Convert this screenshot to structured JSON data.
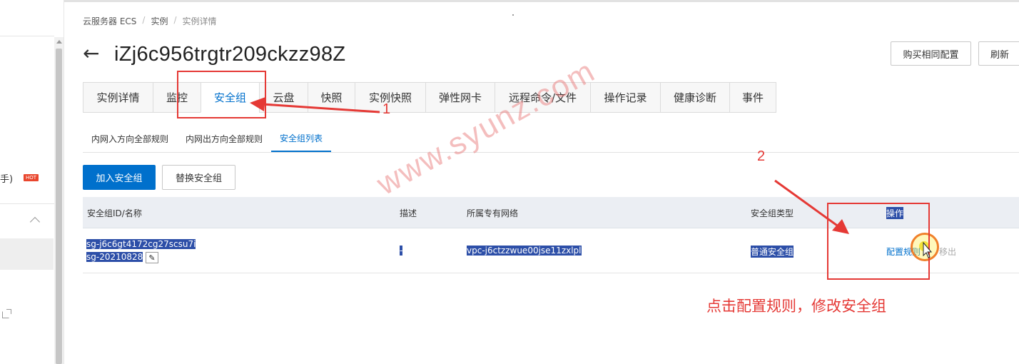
{
  "breadcrumb": [
    "云服务器 ECS",
    "实例",
    "实例详情"
  ],
  "instance_title": "iZj6c956trgtr209ckzz98Z",
  "header_buttons": {
    "buy_same": "购买相同配置",
    "refresh": "刷新"
  },
  "tabs": [
    {
      "label": "实例详情",
      "active": false
    },
    {
      "label": "监控",
      "active": false
    },
    {
      "label": "安全组",
      "active": true
    },
    {
      "label": "云盘",
      "active": false
    },
    {
      "label": "快照",
      "active": false
    },
    {
      "label": "实例快照",
      "active": false
    },
    {
      "label": "弹性网卡",
      "active": false
    },
    {
      "label": "远程命令/文件",
      "active": false
    },
    {
      "label": "操作记录",
      "active": false
    },
    {
      "label": "健康诊断",
      "active": false
    },
    {
      "label": "事件",
      "active": false
    }
  ],
  "subtabs": [
    {
      "label": "内网入方向全部规则",
      "active": false
    },
    {
      "label": "内网出方向全部规则",
      "active": false
    },
    {
      "label": "安全组列表",
      "active": true
    }
  ],
  "actions": {
    "add": "加入安全组",
    "replace": "替换安全组"
  },
  "table": {
    "headers": {
      "id_name": "安全组ID/名称",
      "description": "描述",
      "vpc": "所属专有网络",
      "type": "安全组类型",
      "ops": "操作"
    },
    "rows": [
      {
        "id": "sg-j6c6gt4172cg27scsu7i",
        "name": "sg-20210828",
        "description": "-",
        "vpc": "vpc-j6ctzzwue00jse11zxlpl",
        "type": "普通安全组",
        "op_config": "配置规则",
        "op_remove": "移出"
      }
    ]
  },
  "sidebar": {
    "hot_item_label": "手)",
    "hot_badge": "HOT"
  },
  "annotations": {
    "step1": "1",
    "step2": "2",
    "instruction": "点击配置规则，修改安全组",
    "watermark": "www.syunz.com",
    "color": "#e53935"
  },
  "colors": {
    "primary": "#0070cc",
    "selection": "#2d4fa8"
  }
}
